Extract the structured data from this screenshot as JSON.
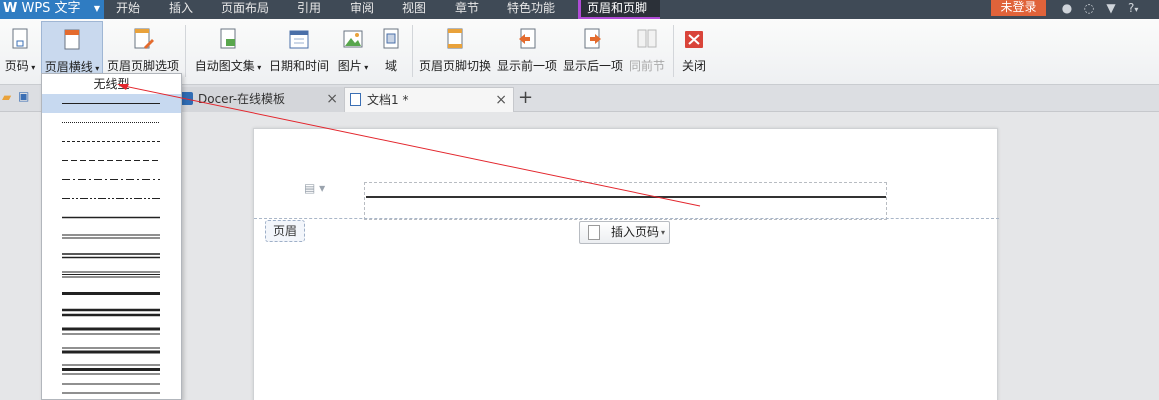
{
  "app": {
    "title": "WPS 文字"
  },
  "menubar": {
    "items": [
      "开始",
      "插入",
      "页面布局",
      "引用",
      "审阅",
      "视图",
      "章节",
      "特色功能"
    ],
    "active": "页眉和页脚",
    "login": "未登录",
    "help": "?"
  },
  "ribbon": {
    "page_number": "页码",
    "header_line": "页眉横线",
    "header_footer_options": "页眉页脚选项",
    "auto_text": "自动图文集",
    "date_time": "日期和时间",
    "picture": "图片",
    "field": "域",
    "switch_header_footer": "页眉页脚切换",
    "show_previous": "显示前一项",
    "show_next": "显示后一项",
    "same_as_previous": "同前节",
    "close": "关闭"
  },
  "tabs": [
    {
      "label": "Docer-在线模板"
    },
    {
      "label": "文档1 *"
    }
  ],
  "document": {
    "header_label": "页眉",
    "insert_page_number": "插入页码"
  },
  "dropdown": {
    "title": "无线型",
    "line_styles": [
      "single-thin",
      "dotted-fine",
      "dashed-small",
      "dashed",
      "dash-dot",
      "dash-dot-dot",
      "single-medium",
      "double-thin",
      "double-medium",
      "triple-thin",
      "thick",
      "double-thick",
      "thick-thin",
      "thin-thick",
      "thin-thick-thin",
      "double-wide",
      "thick-band"
    ]
  },
  "colors": {
    "menubar_bg": "#3f4a56",
    "app_button": "#2f7cc2",
    "login_button": "#e0633a",
    "active_tab_accent": "#b04cd6",
    "close_icon": "#d9443a",
    "annotation_arrow": "#e3262d",
    "selection_highlight": "#c7d9f0"
  }
}
